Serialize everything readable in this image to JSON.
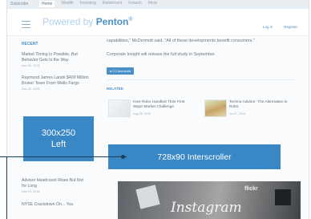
{
  "topbar": {
    "brand": "Subscribe",
    "nav": [
      "Home",
      "Wealth",
      "Investing",
      "Retirement",
      "Fintech",
      "More"
    ]
  },
  "header": {
    "logo_prefix": "Powered by",
    "logo_name": "Penton",
    "logo_mark": "®",
    "links": [
      "Log in",
      "Register"
    ]
  },
  "sidebar": {
    "title": "RECENT",
    "items": [
      {
        "title": "Market Timing Is Possible, But Behavior Gets in the Way",
        "date": "Nov 20, 2015"
      },
      {
        "title": "Raymond James Lands $400 Million Broker Team From Wells Fargo",
        "date": "Nov 20, 2015"
      }
    ],
    "lower_items": [
      {
        "title": "Advisor Headcount Rises But Not for Long",
        "date": "Nov 19, 2015"
      },
      {
        "title": "NYSE Crackdown On... You",
        "date": ""
      }
    ]
  },
  "ads": {
    "left_line1": "300x250",
    "left_line2": "Left",
    "banner": "728x90 Interscroller"
  },
  "article": {
    "quote": "capabilities,\" McDermott said. \"All of these developments benefit consumers.\"",
    "paragraph": "Corporate Insight will release the full study in September.",
    "comments": "0 Comments",
    "related_title": "RELATED",
    "related": [
      {
        "title": "How Robo Handled Their First Major Market Challenge",
        "date": "Aug 25, 2015"
      },
      {
        "title": "Techno Advisor: The Alternative to Robo",
        "date": "Jul 27, 2015"
      }
    ]
  },
  "photo": {
    "brand_a": "Instagram",
    "brand_b": "flickr"
  }
}
